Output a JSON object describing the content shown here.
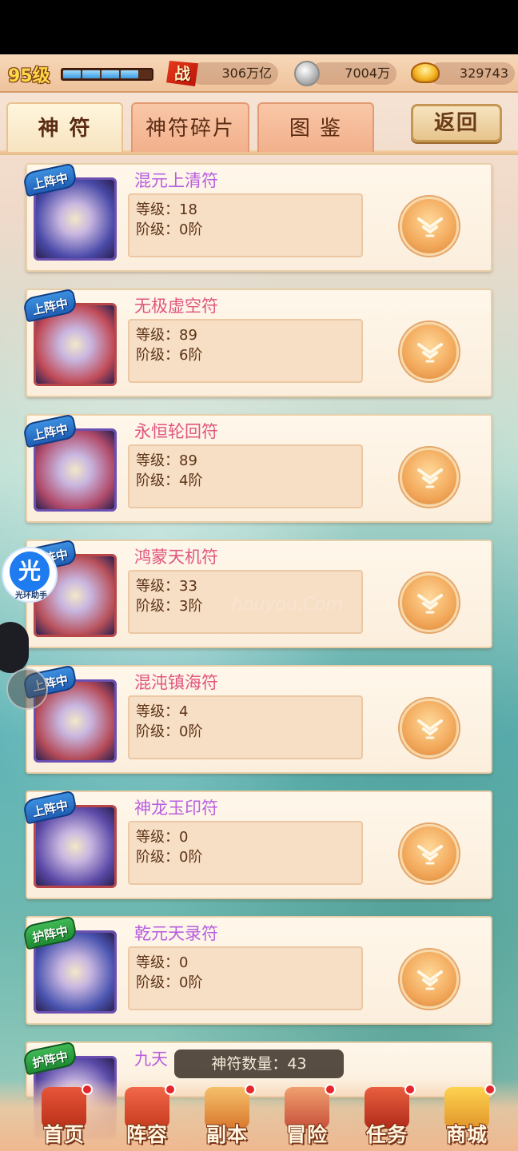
{
  "topbar": {
    "level": "95级",
    "exp_progress": 0.85,
    "power_icon_text": "战",
    "power": "306万亿",
    "silver": "7004万",
    "gold": "329743"
  },
  "tabs": [
    {
      "label": "神 符",
      "active": true
    },
    {
      "label": "神符碎片",
      "active": false
    },
    {
      "label": "图 鉴",
      "active": false
    }
  ],
  "back_label": "返回",
  "cards": [
    {
      "badge": "上阵中",
      "badge_color": "blue",
      "name": "混元上清符",
      "name_color": "#b85ee0",
      "level": "等级：18",
      "stage": "阶级：0阶",
      "art_color": "#4a4aa8"
    },
    {
      "badge": "上阵中",
      "badge_color": "blue",
      "name": "无极虚空符",
      "name_color": "#e0567e",
      "level": "等级：89",
      "stage": "阶级：6阶",
      "art_color": "#c04a57"
    },
    {
      "badge": "上阵中",
      "badge_color": "blue",
      "name": "永恒轮回符",
      "name_color": "#e0567e",
      "level": "等级：89",
      "stage": "阶级：4阶",
      "art_color": "#b04a6a"
    },
    {
      "badge": "上阵中",
      "badge_color": "blue",
      "name": "鸿蒙天机符",
      "name_color": "#e0567e",
      "level": "等级：33",
      "stage": "阶级：3阶",
      "art_color": "#b8505a"
    },
    {
      "badge": "上阵中",
      "badge_color": "blue",
      "name": "混沌镇海符",
      "name_color": "#e0567e",
      "level": "等级：4",
      "stage": "阶级：0阶",
      "art_color": "#b44a58"
    },
    {
      "badge": "上阵中",
      "badge_color": "blue",
      "name": "神龙玉印符",
      "name_color": "#b85ee0",
      "level": "等级：0",
      "stage": "阶级：0阶",
      "art_color": "#5c4aa8"
    },
    {
      "badge": "护阵中",
      "badge_color": "green",
      "name": "乾元天录符",
      "name_color": "#b85ee0",
      "level": "等级：0",
      "stage": "阶级：0阶",
      "art_color": "#4a54b0"
    },
    {
      "badge": "护阵中",
      "badge_color": "green",
      "name": "九天",
      "name_color": "#b85ee0",
      "level": "",
      "stage": "",
      "art_color": "#5a4aa8"
    }
  ],
  "count_label": "神符数量：43",
  "nav": [
    {
      "label": "首页",
      "color": "#d84a2a"
    },
    {
      "label": "阵容",
      "color": "#e0523a"
    },
    {
      "label": "副本",
      "color": "#e89a3a"
    },
    {
      "label": "冒险",
      "color": "#d8573a"
    },
    {
      "label": "任务",
      "color": "#c84a3a"
    },
    {
      "label": "商城",
      "color": "#e0a02a"
    }
  ],
  "floating": {
    "helper_glyph": "光",
    "helper_label": "光环助手"
  },
  "watermark": "houyou.Com"
}
